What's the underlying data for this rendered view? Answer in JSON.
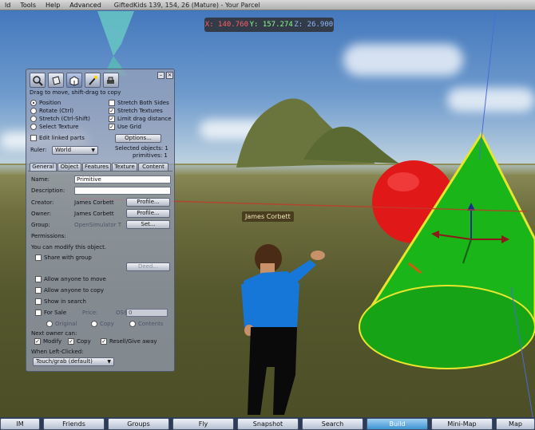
{
  "menubar": {
    "items": [
      "ld",
      "Tools",
      "Help",
      "Advanced"
    ],
    "parcel": "GiftedKids 139, 154, 26 (Mature) - Your Parcel"
  },
  "coords": {
    "x": "X: 140.760",
    "y": "Y: 157.274",
    "z": "Z: 26.900"
  },
  "avatar": {
    "name": "James Corbett"
  },
  "build": {
    "hint": "Drag to move, shift-drag to copy",
    "modes": [
      "Position",
      "Rotate (Ctrl)",
      "Stretch (Ctrl-Shift)",
      "Select Texture"
    ],
    "selected_mode": 0,
    "options_right": [
      {
        "label": "Stretch Both Sides",
        "checked": false
      },
      {
        "label": "Stretch Textures",
        "checked": true
      },
      {
        "label": "Limit drag distance",
        "checked": true
      },
      {
        "label": "Use Grid",
        "checked": true
      }
    ],
    "edit_linked": "Edit linked parts",
    "options_button": "Options...",
    "ruler_label": "Ruler:",
    "ruler_value": "World",
    "selected_objects": "Selected objects: 1",
    "primitives": "primitives: 1",
    "tabs": [
      "General",
      "Object",
      "Features",
      "Texture",
      "Content"
    ],
    "active_tab": 0,
    "general": {
      "name_label": "Name:",
      "name_value": "Primitive",
      "description_label": "Description:",
      "description_value": "",
      "creator_label": "Creator:",
      "creator_value": "James Corbett",
      "owner_label": "Owner:",
      "owner_value": "James Corbett",
      "group_label": "Group:",
      "group_value": "OpenSimulator T",
      "profile_button": "Profile...",
      "set_button": "Set...",
      "permissions_label": "Permissions:",
      "modify_note": "You can modify this object.",
      "share_group": "Share with group",
      "deed_button": "Deed...",
      "allow_move": "Allow anyone to move",
      "allow_copy": "Allow anyone to copy",
      "show_search": "Show in search",
      "for_sale": "For Sale",
      "price_label": "Price:",
      "price_currency": "OS$",
      "price_value": "0",
      "sale_original": "Original",
      "sale_copy": "Copy",
      "sale_contents": "Contents",
      "next_owner_label": "Next owner can:",
      "next_modify": "Modify",
      "next_copy": "Copy",
      "next_resell": "Resell/Give away",
      "left_click_label": "When Left-Clicked:",
      "left_click_value": "Touch/grab (default)"
    }
  },
  "bottombar": {
    "buttons": [
      "IM",
      "Friends",
      "Groups",
      "Fly",
      "Snapshot",
      "Search",
      "Build",
      "Mini-Map",
      "Map"
    ],
    "active": "Build"
  }
}
